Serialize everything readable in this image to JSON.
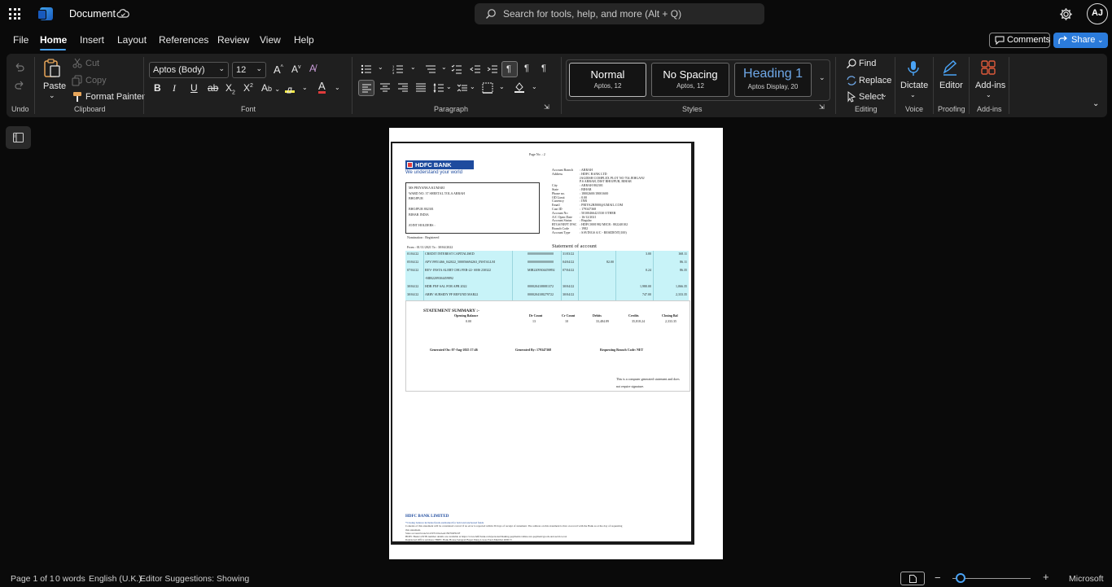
{
  "titlebar": {
    "doc_title": "Document",
    "search_placeholder": "Search for tools, help, and more (Alt + Q)",
    "avatar_initials": "AJ"
  },
  "menu": {
    "items": [
      "File",
      "Home",
      "Insert",
      "Layout",
      "References",
      "Review",
      "View",
      "Help"
    ],
    "active": "Home",
    "comments_label": "Comments",
    "share_label": "Share"
  },
  "ribbon": {
    "undo_group": "Undo",
    "clipboard": {
      "paste": "Paste",
      "cut": "Cut",
      "copy": "Copy",
      "format_painter": "Format Painter",
      "label": "Clipboard"
    },
    "font": {
      "name": "Aptos (Body)",
      "size": "12",
      "label": "Font"
    },
    "paragraph": {
      "label": "Paragraph"
    },
    "styles": {
      "items": [
        {
          "name": "Normal",
          "sub": "Aptos, 12"
        },
        {
          "name": "No Spacing",
          "sub": "Aptos, 12"
        },
        {
          "name": "Heading 1",
          "sub": "Aptos Display, 20"
        }
      ],
      "label": "Styles"
    },
    "editing": {
      "find": "Find",
      "replace": "Replace",
      "select": "Select",
      "label": "Editing"
    },
    "voice": {
      "dictate": "Dictate",
      "label": "Voice"
    },
    "proofing": {
      "editor": "Editor",
      "label": "Proofing"
    },
    "addins": {
      "addins": "Add-ins",
      "label": "Add-ins"
    }
  },
  "colors": {
    "accent": "#4aa3f5",
    "share": "#2b7bdb",
    "ribbon_bg": "#1f1f1f",
    "app_bg": "#0a0a0a",
    "hdfc_blue": "#1e4b9e",
    "table_cyan": "#c8f3f8"
  },
  "document": {
    "page_no": "Page No .: 2",
    "bank_name": "HDFC BANK",
    "tagline": "We understand your world",
    "branch_fields": [
      [
        "Account Branch",
        ": ARRAH"
      ],
      [
        "Address",
        ": HDFC BANK LTD"
      ],
      [
        "",
        "JAGDISH COMPLEX PLOT NO 704 JEHGANJ"
      ],
      [
        "",
        "P.S ARRAH, DIST BHOJPUR, BIHAR"
      ],
      [
        "City",
        ": ARRAH 802301"
      ],
      [
        "State",
        ": BIHAR"
      ],
      [
        "Phone no.",
        ": 18002600/18001600"
      ],
      [
        "OD Limit",
        ": 0.00"
      ],
      [
        "Currency",
        ": INR"
      ],
      [
        "Email",
        ": PRIYA2HJ000@GMAIL.COM"
      ],
      [
        "Cust ID",
        ": 179347368"
      ],
      [
        "Account No",
        ": 50100466421530  OTHER"
      ],
      [
        "A/C Open Date",
        ": 16/12/2021"
      ],
      [
        "Account Status",
        ": Regular"
      ],
      [
        "RTGS/NEFT IFSC",
        ": HDFC0001982     MICR : 802240102"
      ],
      [
        "Branch Code",
        ": 1982"
      ],
      [
        "Account Type",
        ": SAVINGS A/C - RESIDENT(100)"
      ]
    ],
    "holder_lines": [
      "MS    PRIYANKA KUMARI",
      "WARD NO. 37   SHEETAL TOLA ARRAH",
      "BHOJPUR",
      "",
      "BHOJPUR 802301",
      "BIHAR INDIA",
      "",
      "JOINT HOLDERS :"
    ],
    "nomination": "Nomination : Registered",
    "from_to": "From :  01/11/2021          To :  30/04/2022",
    "statement_title": "Statement of account",
    "transactions": [
      {
        "date": "01/04/22",
        "narration": "CREDIT INTEREST CAPITALISED",
        "ref": "0000000000000000",
        "vdate": "31/03/22",
        "debit": "",
        "credit": "3.00",
        "balance": "168.11"
      },
      {
        "date": "05/04/22",
        "narration": "APY19951466_042022_500056694263_INSTALLM",
        "ref": "0000000000000000",
        "vdate": "04/04/22",
        "debit": "82.00",
        "credit": "",
        "balance": "86.11"
      },
      {
        "date": "07/04/22",
        "narration": "REV- INSTA ALERT CHG FEB-22- SMS 230322",
        "ref": "MIR2209304459892",
        "vdate": "07/04/22",
        "debit": "",
        "credit": "0.24",
        "balance": "86.35"
      },
      {
        "date": "",
        "narration": "-MIR2209304459892",
        "ref": "",
        "vdate": "",
        "debit": "",
        "credit": "",
        "balance": ""
      },
      {
        "date": "30/04/22",
        "narration": "HDB FNF SAL FOR APR 2022",
        "ref": "0000204108081372",
        "vdate": "30/04/22",
        "debit": "",
        "credit": "1,980.00",
        "balance": "1,066.35"
      },
      {
        "date": "30/04/22",
        "narration": "ARRV SUBSIDY FF REFUND MAR22",
        "ref": "0000204108279722",
        "vdate": "30/04/22",
        "debit": "",
        "credit": "747.00",
        "balance": "2,333.35"
      }
    ],
    "summary_title": "STATEMENT SUMMARY  :-",
    "summary_headers": [
      "Opening Balance",
      "Dr Count",
      "Cr Count",
      "Debits",
      "Credits",
      "Closing Bal"
    ],
    "summary_values": [
      "0.00",
      "13",
      "10",
      "33,484.89",
      "35,818.24",
      "2,333.35"
    ],
    "generated_on": "Generated On:  07-Aug-2025 17:46",
    "generated_by": "Generated By: 179347368",
    "requesting_branch": "Requesting Branch Code: NET",
    "computer_generated": [
      "This is a computer generated statement and does",
      "not require signature."
    ],
    "footer": [
      "HDFC BANK LIMITED",
      "*Closing balance includes funds earmarked for hold and uncleared funds",
      "Contents of this statement will be considered correct if no error is reported within 30 days of receipt of statement. The address on this statement is that on record with the Bank as at the day of requesting",
      "this statement.",
      "State account branch GSTN:10AAACH2702H1ZF",
      "HDFC Bank GSTIN number details are available at https://www.hdfcbank.com/personal/making-payments/online-tax-payment/goods-and-service-tax",
      "Registered Office Address: HDFC Bank House,Senapati Bapat Marg,Lower Parel,Mumbai 400013"
    ]
  },
  "statusbar": {
    "page": "Page 1 of 1",
    "words": "0 words",
    "language": "English (U.K.)",
    "editor_suggestions": "Editor Suggestions: Showing",
    "zoom_fraction": 0.1,
    "brand": "Microsoft"
  }
}
